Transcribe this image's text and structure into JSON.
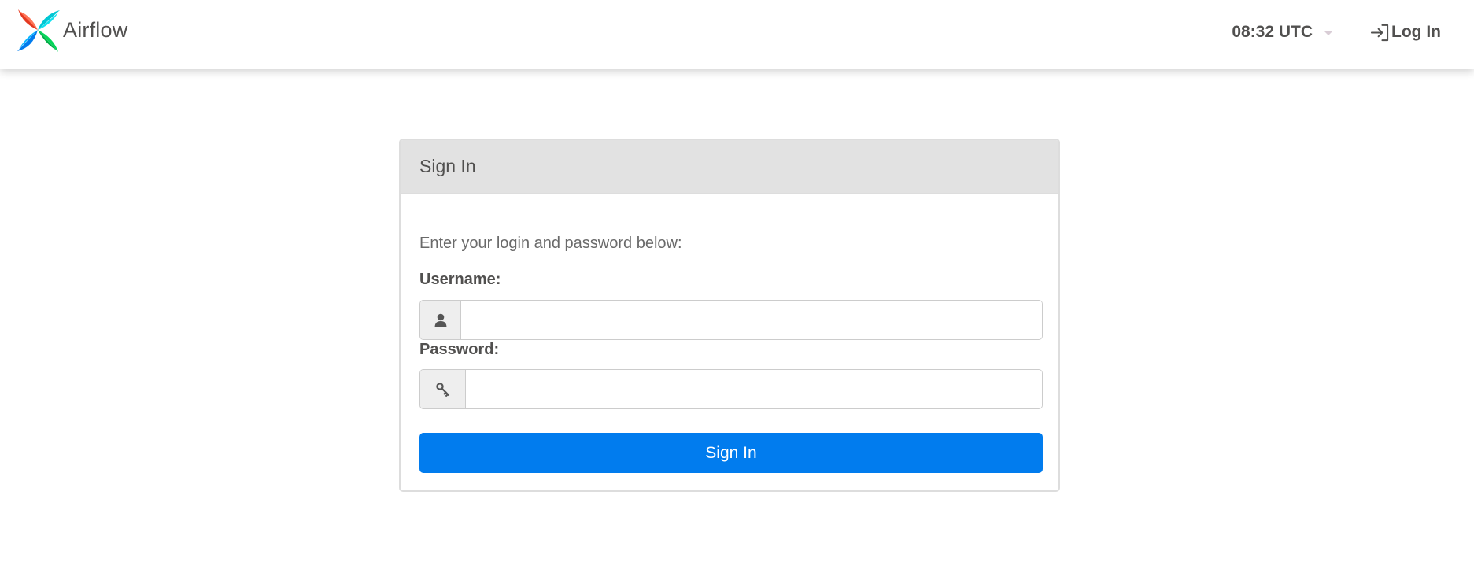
{
  "navbar": {
    "brand_name": "Airflow",
    "clock": "08:32 UTC",
    "login_label": "Log In"
  },
  "login_form": {
    "heading": "Sign In",
    "intro": "Enter your login and password below:",
    "username_label": "Username:",
    "username_value": "",
    "password_label": "Password:",
    "password_value": "",
    "submit_label": "Sign In"
  },
  "icons": {
    "logo": "airflow-pinwheel-icon",
    "login": "login-arrow-icon",
    "username": "user-icon",
    "password": "key-icon",
    "clock_menu": "caret-down-icon"
  },
  "colors": {
    "primary": "#017cee",
    "navbar_bg": "#ffffff",
    "panel_heading_bg": "#e2e2e2",
    "text": "#51504f",
    "logo_red": "#e43921",
    "logo_cyan": "#00c7d4",
    "logo_blue": "#017cee",
    "logo_green": "#04d659"
  }
}
